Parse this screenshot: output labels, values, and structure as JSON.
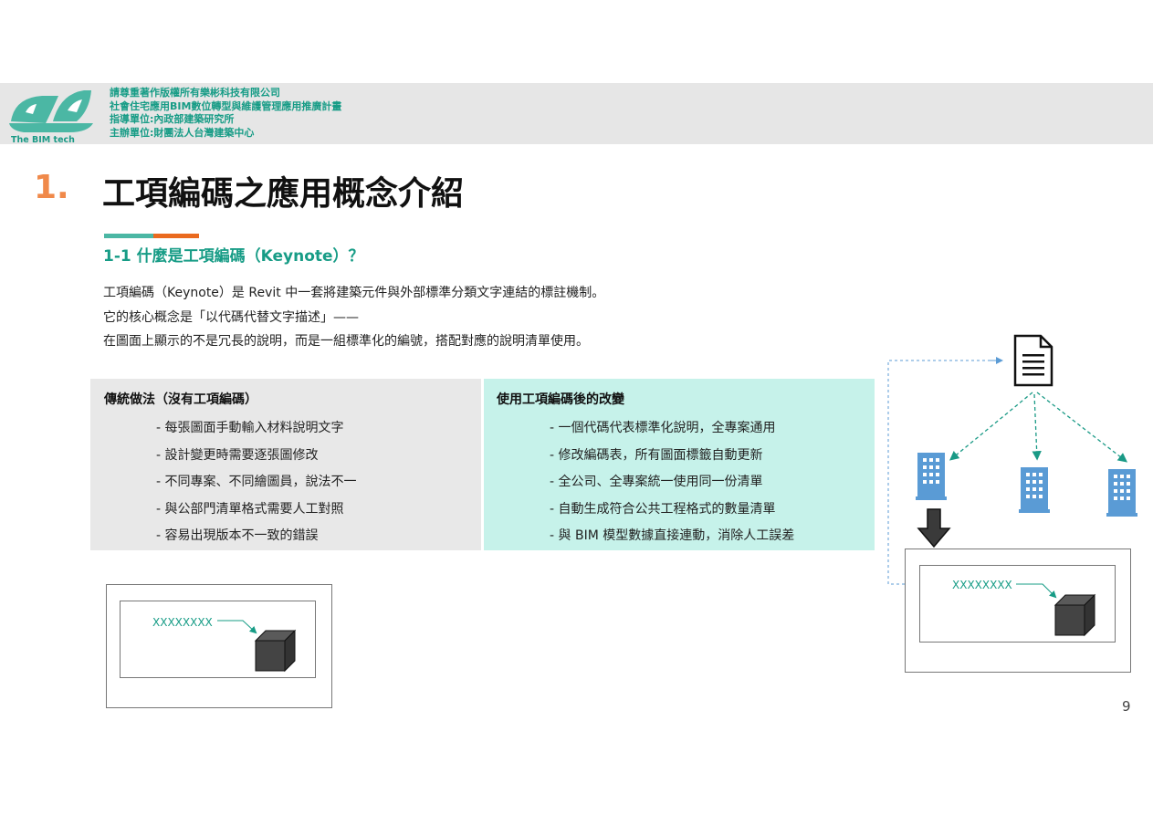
{
  "header": {
    "brand": "The BIM tech",
    "lines": [
      "請尊重著作版權所有樂彬科技有限公司",
      "社會住宅應用BIM數位轉型與維護管理應用推廣計畫",
      "指導單位:內政部建築研究所",
      "主辦單位:財團法人台灣建築中心"
    ]
  },
  "title": {
    "number": "1.",
    "text": "工項編碼之應用概念介紹"
  },
  "subtitle": "1-1 什麼是工項編碼（Keynote）？",
  "intro": [
    "工項編碼（Keynote）是 Revit 中一套將建築元件與外部標準分類文字連結的標註機制。",
    "它的核心概念是「以代碼代替文字描述」——",
    "在圖面上顯示的不是冗長的說明，而是一組標準化的編號，搭配對應的說明清單使用。"
  ],
  "comparison": {
    "left": {
      "heading": "傳統做法（沒有工項編碼）",
      "items": [
        "每張圖面手動輸入材料說明文字",
        "設計變更時需要逐張圖修改",
        "不同專案、不同繪圖員，說法不一",
        "與公部門清單格式需要人工對照",
        "容易出現版本不一致的錯誤"
      ]
    },
    "right": {
      "heading": "使用工項編碼後的改變",
      "items": [
        "一個代碼代表標準化說明，全專案通用",
        "修改編碼表，所有圖面標籤自動更新",
        "全公司、全專案統一使用同一份清單",
        "自動生成符合公共工程格式的數量清單",
        "與 BIM 模型數據直接連動，消除人工誤差"
      ]
    }
  },
  "diagram": {
    "left_label": "XXXXXXXX",
    "right_label": "XXXXXXXX",
    "icons": [
      "document-icon",
      "building-icon",
      "down-arrow-icon",
      "cube-icon"
    ]
  },
  "page_number": "9",
  "colors": {
    "accent_teal": "#179c86",
    "accent_orange": "#f0894a",
    "banner_bg": "#e6e6e6",
    "right_column_bg": "#c6f2ea",
    "building_blue": "#5a9bd5",
    "dashed_link": "#5b9bd5"
  }
}
